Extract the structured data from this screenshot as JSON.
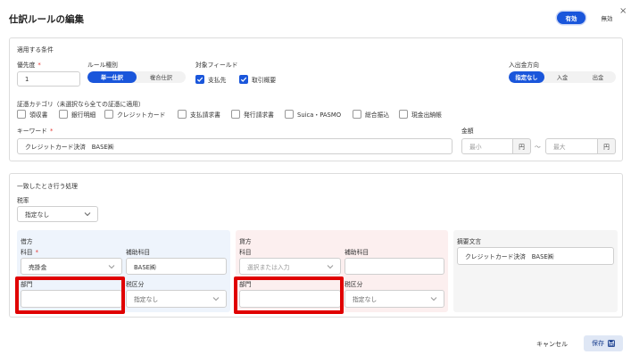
{
  "header": {
    "title": "仕訳ルールの編集",
    "close_symbol": "×",
    "status_on_label": "有効",
    "status_off_label": "無効"
  },
  "conditions": {
    "section_title": "適用する条件",
    "priority": {
      "label": "優先度",
      "required": "*",
      "value": "1"
    },
    "rule_type": {
      "label": "ルール種別",
      "options": [
        "単一仕訳",
        "複合仕訳"
      ],
      "selected": "単一仕訳"
    },
    "target_fields": {
      "label": "対象フィールド",
      "items": [
        {
          "label": "支払先",
          "checked": true
        },
        {
          "label": "取引概要",
          "checked": true
        }
      ]
    },
    "direction": {
      "label": "入出金方向",
      "options": [
        "指定なし",
        "入金",
        "出金"
      ],
      "selected": "指定なし"
    },
    "categories": {
      "label": "証憑カテゴリ（未選択なら全ての証憑に適用）",
      "items": [
        "領収書",
        "銀行明細",
        "クレジットカード",
        "支払請求書",
        "発行請求書",
        "Suica・PASMO",
        "総合振込",
        "現金出納帳"
      ]
    },
    "keyword": {
      "label": "キーワード",
      "required": "*",
      "value": "クレジットカード決済　BASE㈱"
    },
    "amount": {
      "label": "金額",
      "min_placeholder": "最小",
      "max_placeholder": "最大",
      "unit": "円",
      "separator": "〜"
    }
  },
  "actions": {
    "section_title": "一致したとき行う処理",
    "tax_rate": {
      "label": "税率",
      "value": "指定なし"
    },
    "debit": {
      "title": "借方",
      "account_label": "科目",
      "account_required": "*",
      "account_value": "売掛金",
      "sub_label": "補助科目",
      "sub_value": "BASE㈱",
      "dept_label": "部門",
      "dept_value": "",
      "tax_label": "税区分",
      "tax_value": "指定なし"
    },
    "credit": {
      "title": "貸方",
      "account_label": "科目",
      "account_placeholder": "選択または入力",
      "sub_label": "補助科目",
      "sub_value": "",
      "dept_label": "部門",
      "dept_value": "",
      "tax_label": "税区分",
      "tax_value": "指定なし"
    },
    "memo": {
      "label": "摘要文言",
      "value": "クレジットカード決済　BASE㈱"
    }
  },
  "footer": {
    "cancel_label": "キャンセル",
    "save_label": "保存"
  },
  "colors": {
    "accent": "#1a56db",
    "highlight": "#e00000"
  }
}
